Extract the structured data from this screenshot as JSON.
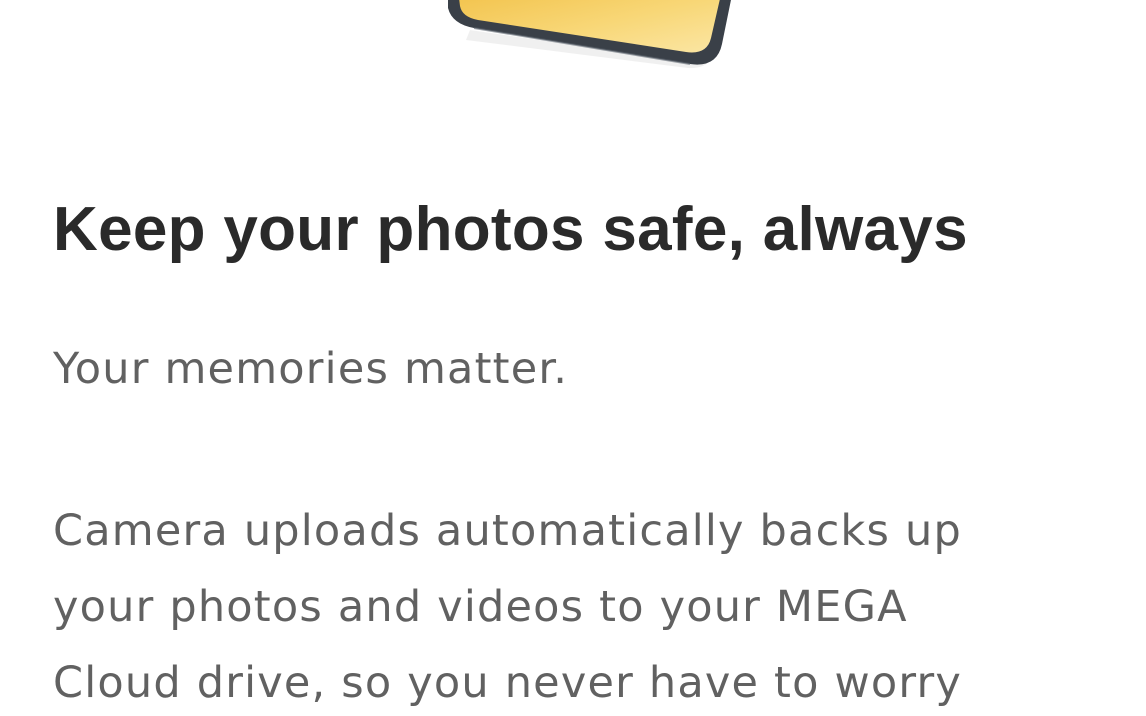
{
  "onboarding": {
    "illustration_icon": "phone-with-photo-icon",
    "title": "Keep your photos safe, always",
    "subtitle": "Your memories matter.",
    "description_lines": [
      "Camera uploads automatically backs up",
      "your photos and videos to your MEGA",
      "Cloud drive, so you never have to worry"
    ]
  },
  "colors": {
    "phone_frame": "#3a4048",
    "phone_screen": "#f6cf63",
    "title_text": "#2a2a2a",
    "body_text": "#616161",
    "background": "#ffffff"
  }
}
